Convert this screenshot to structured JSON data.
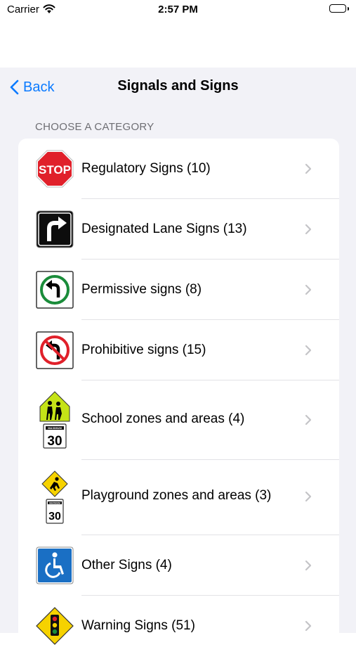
{
  "status": {
    "carrier": "Carrier",
    "time": "2:57 PM"
  },
  "nav": {
    "back_label": "Back",
    "title": "Signals and Signs"
  },
  "section": {
    "header": "CHOOSE A CATEGORY"
  },
  "categories": [
    {
      "label": "Regulatory Signs (10)",
      "icon": "stop-sign-icon"
    },
    {
      "label": "Designated Lane Signs (13)",
      "icon": "turn-right-arrow-icon"
    },
    {
      "label": "Permissive signs (8)",
      "icon": "left-turn-permitted-icon"
    },
    {
      "label": "Prohibitive signs (15)",
      "icon": "no-left-turn-icon"
    },
    {
      "label": "School zones and areas (4)",
      "icon": "school-zone-icon"
    },
    {
      "label": "Playground zones and areas (3)",
      "icon": "playground-zone-icon"
    },
    {
      "label": "Other Signs (4)",
      "icon": "wheelchair-accessible-icon"
    },
    {
      "label": "Warning Signs (51)",
      "icon": "traffic-light-warning-icon"
    }
  ],
  "sign_text": {
    "stop": "STOP",
    "maximum": "MAXIMUM",
    "speed": "30"
  },
  "colors": {
    "accent": "#0a7aff",
    "background": "#f2f2f7",
    "stop_red": "#e0202a",
    "permissive_green": "#1a8c3a",
    "school_yellow_green": "#c5e317",
    "warning_yellow": "#f6d200",
    "accessible_blue": "#1a6fc4"
  }
}
